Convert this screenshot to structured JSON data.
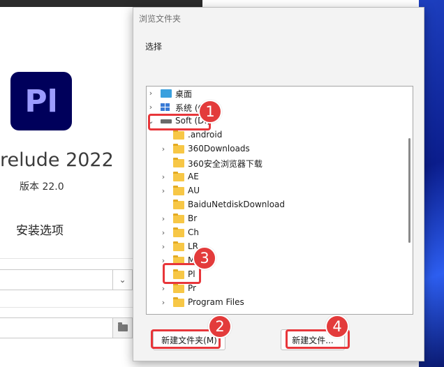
{
  "installer": {
    "logo_text": "Pl",
    "product_name": "relude 2022",
    "version": "版本 22.0",
    "options_title": "安装选项",
    "logo_color": "#00005b"
  },
  "dialog": {
    "title": "浏览文件夹",
    "prompt": "选择",
    "tree": [
      {
        "label": "桌面",
        "icon": "desktop-icon",
        "expandable": true
      },
      {
        "label": "系统 (C:",
        "icon": "system-icon",
        "expandable": true
      },
      {
        "label": "Soft (D:)",
        "icon": "drive-icon",
        "expandable": true,
        "expanded": true
      },
      {
        "label": ".android",
        "icon": "folder-icon",
        "expandable": false
      },
      {
        "label": "360Downloads",
        "icon": "folder-icon",
        "expandable": true
      },
      {
        "label": "360安全浏览器下载",
        "icon": "folder-icon",
        "expandable": false
      },
      {
        "label": "AE",
        "icon": "folder-icon",
        "expandable": true
      },
      {
        "label": "AU",
        "icon": "folder-icon",
        "expandable": true
      },
      {
        "label": "BaiduNetdiskDownload",
        "icon": "folder-icon",
        "expandable": false
      },
      {
        "label": "Br",
        "icon": "folder-icon",
        "expandable": true
      },
      {
        "label": "Ch",
        "icon": "folder-icon",
        "expandable": true
      },
      {
        "label": "LR",
        "icon": "folder-icon",
        "expandable": true
      },
      {
        "label": "M",
        "icon": "folder-icon",
        "expandable": true
      },
      {
        "label": "Pl",
        "icon": "folder-icon",
        "expandable": false
      },
      {
        "label": "Pr",
        "icon": "folder-icon",
        "expandable": true
      },
      {
        "label": "Program Files",
        "icon": "folder-icon",
        "expandable": true
      }
    ],
    "new_folder_button": "新建文件夹(M)",
    "new_folder_button_2": "新建文件..."
  },
  "annotations": {
    "badges": [
      "1",
      "2",
      "3",
      "4"
    ],
    "color": "#e8363a"
  }
}
